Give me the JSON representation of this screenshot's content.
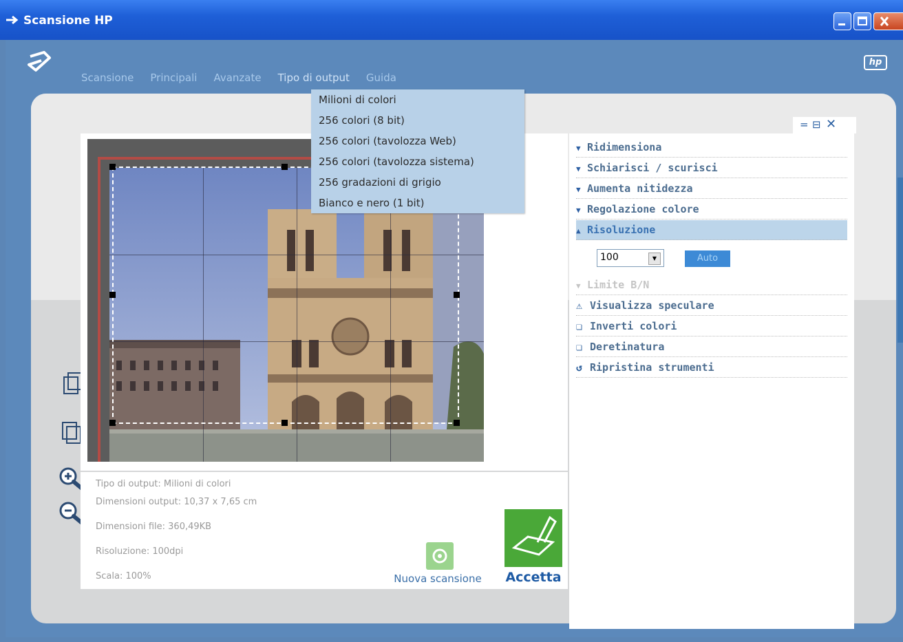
{
  "window": {
    "title": "Scansione HP",
    "controls": [
      "minimize",
      "maximize",
      "close"
    ],
    "brand_icon": "hp-logo"
  },
  "menu": {
    "items": [
      {
        "label": "Scansione"
      },
      {
        "label": "Principali"
      },
      {
        "label": "Avanzate"
      },
      {
        "label": "Tipo di output"
      },
      {
        "label": "Guida"
      }
    ],
    "open_dropdown": {
      "parent": "Tipo di output",
      "items": [
        "Milioni di colori",
        "256 colori (8 bit)",
        "256 colori (tavolozza Web)",
        "256 colori (tavolozza sistema)",
        "256 gradazioni di grigio",
        "Bianco e nero (1 bit)"
      ]
    }
  },
  "info": {
    "output_type": "Tipo di output: Milioni di colori",
    "output_size": "Dimensioni output: 10,37 x 7,65 cm",
    "file_size": "Dimensioni file: 360,49KB",
    "resolution": "Risoluzione:  100dpi",
    "scale": "Scala: 100%"
  },
  "actions": {
    "new_scan": "Nuova scansione",
    "accept": "Accetta"
  },
  "tools_panel": {
    "items": [
      {
        "label": "Ridimensiona",
        "state": "collapsed"
      },
      {
        "label": "Schiarisci / scurisci",
        "state": "collapsed"
      },
      {
        "label": "Aumenta nitidezza",
        "state": "collapsed"
      },
      {
        "label": "Regolazione colore",
        "state": "collapsed"
      },
      {
        "label": "Risoluzione",
        "state": "expanded"
      },
      {
        "label": "Limite B/N",
        "state": "disabled"
      },
      {
        "label": "Visualizza speculare",
        "icon": "mirror-icon"
      },
      {
        "label": "Inverti colori",
        "icon": "invert-icon"
      },
      {
        "label": "Deretinatura",
        "icon": "descreen-icon"
      },
      {
        "label": "Ripristina strumenti",
        "icon": "undo-icon"
      }
    ],
    "resolution_value": "100",
    "auto_label": "Auto"
  },
  "colors": {
    "titlebar": "#1e5fd7",
    "app_bg": "#5c89bb",
    "accent_green": "#4aa838",
    "dropdown_bg": "#b8d1e8"
  }
}
